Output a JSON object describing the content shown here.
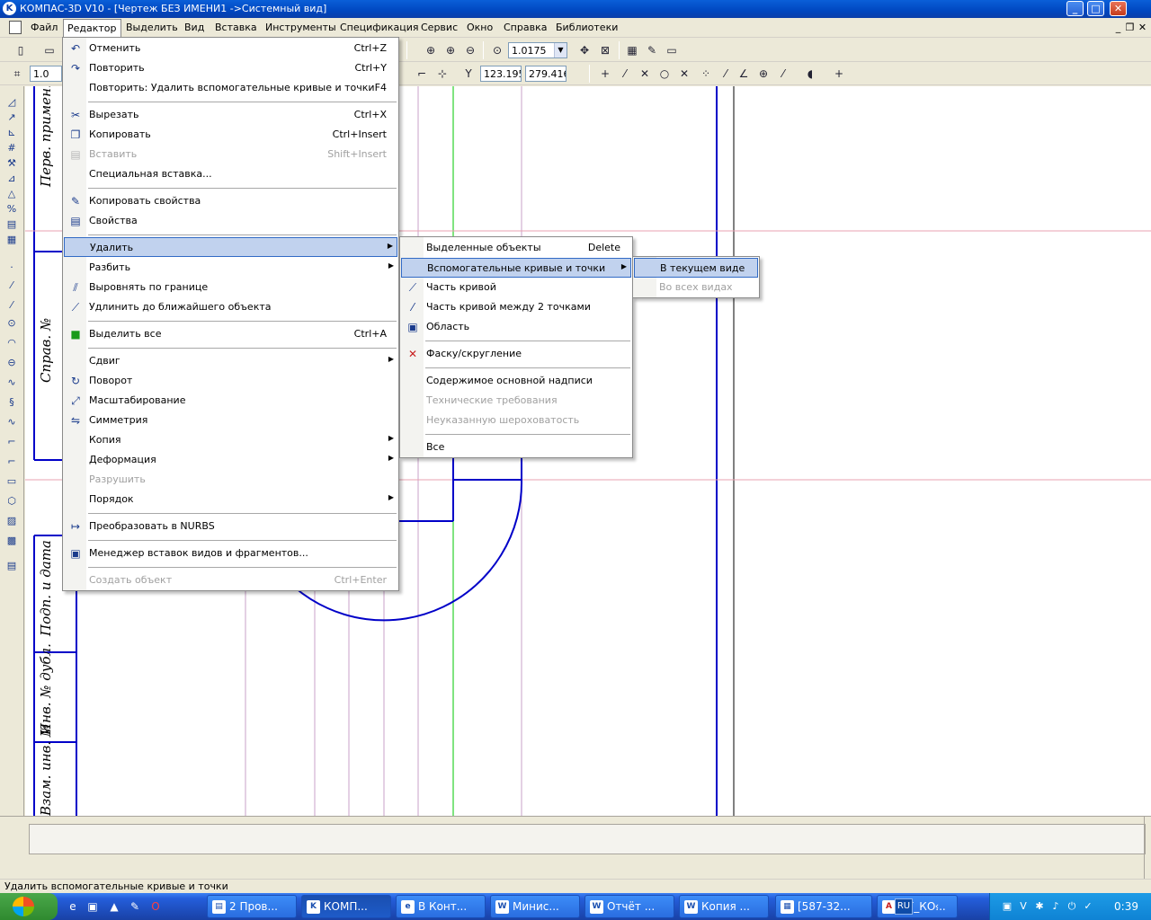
{
  "window": {
    "title": "КОМПАС-3D V10 - [Чертеж БЕЗ ИМЕНИ1 ->Системный вид]"
  },
  "menubar": {
    "items": [
      "Файл",
      "Редактор",
      "Выделить",
      "Вид",
      "Вставка",
      "Инструменты",
      "Спецификация",
      "Сервис",
      "Окно",
      "Справка",
      "Библиотеки"
    ],
    "active": "Редактор"
  },
  "toolbar": {
    "zoom_value": "1.0175",
    "scale_value": "1.0",
    "coord_x": "123.195",
    "coord_y": "279.416"
  },
  "edit_menu": {
    "items": [
      {
        "label": "Отменить",
        "shortcut": "Ctrl+Z",
        "icon": "undo-icon"
      },
      {
        "label": "Повторить",
        "shortcut": "Ctrl+Y",
        "icon": "redo-icon"
      },
      {
        "label": "Повторить: Удалить вспомогательные кривые и точки",
        "shortcut": "F4"
      },
      {
        "label": "Вырезать",
        "shortcut": "Ctrl+X",
        "icon": "cut-icon"
      },
      {
        "label": "Копировать",
        "shortcut": "Ctrl+Insert",
        "icon": "copy-icon"
      },
      {
        "label": "Вставить",
        "shortcut": "Shift+Insert",
        "icon": "paste-icon",
        "disabled": true
      },
      {
        "label": "Специальная вставка..."
      },
      {
        "label": "Копировать свойства",
        "icon": "brush-icon"
      },
      {
        "label": "Свойства",
        "icon": "properties-icon"
      },
      {
        "label": "Удалить",
        "submenu": true
      },
      {
        "label": "Разбить",
        "submenu": true
      },
      {
        "label": "Выровнять по границе",
        "icon": "align-border-icon"
      },
      {
        "label": "Удлинить до ближайшего объекта",
        "icon": "extend-icon"
      },
      {
        "label": "Выделить все",
        "shortcut": "Ctrl+A",
        "icon": "select-all-icon"
      },
      {
        "label": "Сдвиг",
        "submenu": true
      },
      {
        "label": "Поворот",
        "icon": "rotate-icon"
      },
      {
        "label": "Масштабирование",
        "icon": "scale-icon"
      },
      {
        "label": "Симметрия",
        "icon": "symmetry-icon"
      },
      {
        "label": "Копия",
        "submenu": true
      },
      {
        "label": "Деформация",
        "submenu": true
      },
      {
        "label": "Разрушить",
        "disabled": true
      },
      {
        "label": "Порядок",
        "submenu": true
      },
      {
        "label": "Преобразовать в NURBS",
        "icon": "nurbs-icon"
      },
      {
        "label": "Менеджер вставок видов и фрагментов...",
        "icon": "insert-manager-icon"
      },
      {
        "label": "Создать объект",
        "shortcut": "Ctrl+Enter",
        "disabled": true
      }
    ]
  },
  "delete_submenu": {
    "items": [
      {
        "label": "Выделенные объекты",
        "shortcut": "Delete"
      },
      {
        "label": "Вспомогательные кривые и точки",
        "submenu": true
      },
      {
        "label": "Часть кривой",
        "icon": "curve-part-icon"
      },
      {
        "label": "Часть кривой между 2 точками",
        "icon": "curve-between-points-icon"
      },
      {
        "label": "Область",
        "icon": "area-icon"
      },
      {
        "label": "Фаску/скругление",
        "icon": "chamfer-delete-icon"
      },
      {
        "label": "Содержимое основной надписи"
      },
      {
        "label": "Технические требования",
        "disabled": true
      },
      {
        "label": "Неуказанную шероховатость",
        "disabled": true
      },
      {
        "label": "Все"
      }
    ]
  },
  "aux_submenu": {
    "items": [
      {
        "label": "В текущем виде"
      },
      {
        "label": "Во всех видах",
        "disabled": true
      }
    ]
  },
  "drawing": {
    "frame_labels": [
      "Перв. примен.",
      "Справ. №",
      "Подп. и дата",
      "Инв. № дубл.",
      "Взам. инв. №"
    ]
  },
  "status": {
    "text": "Удалить вспомогательные кривые и точки"
  },
  "taskbar": {
    "buttons": [
      "2 Пров...",
      "КОМП...",
      "В Конт...",
      "Минис...",
      "Отчёт ...",
      "Копия ...",
      "[587-32...",
      "ИГ_КО..."
    ],
    "language": "RU",
    "clock": "0:39"
  }
}
